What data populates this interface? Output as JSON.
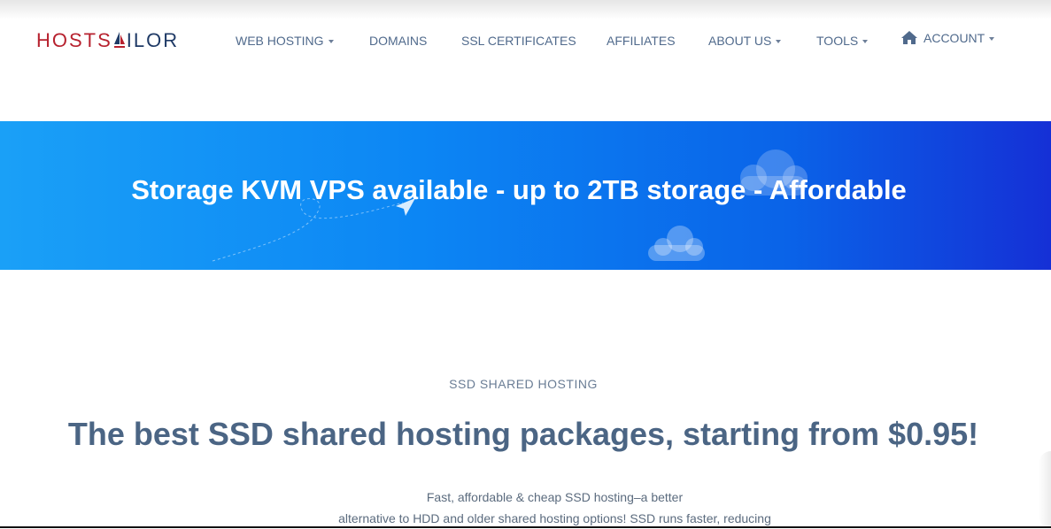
{
  "header": {
    "logo_text_a": "HOSTS",
    "logo_text_b": "ILOR",
    "nav": [
      {
        "label": "WEB HOSTING",
        "dropdown": true
      },
      {
        "label": "DOMAINS",
        "dropdown": false
      },
      {
        "label": "SSL CERTIFICATES",
        "dropdown": false
      },
      {
        "label": "AFFILIATES",
        "dropdown": false
      },
      {
        "label": "ABOUT US",
        "dropdown": true
      },
      {
        "label": "TOOLS",
        "dropdown": true
      },
      {
        "label": "ACCOUNT",
        "dropdown": true,
        "icon": "home-icon"
      }
    ]
  },
  "banner": {
    "text": "Storage KVM VPS available - up to 2TB storage - Affordable",
    "colors": {
      "start": "#1aa0f7",
      "end": "#1530d6"
    }
  },
  "section": {
    "eyebrow": "SSD SHARED HOSTING",
    "headline": "The best SSD shared hosting packages, starting from $0.95!",
    "desc_line1": "Fast, affordable & cheap SSD hosting–a better",
    "desc_line2": "alternative to HDD and older shared hosting options! SSD runs faster, reducing"
  },
  "colors": {
    "brand_red": "#b7222f",
    "brand_navy": "#1f3a66",
    "nav_text": "#506a8c"
  }
}
